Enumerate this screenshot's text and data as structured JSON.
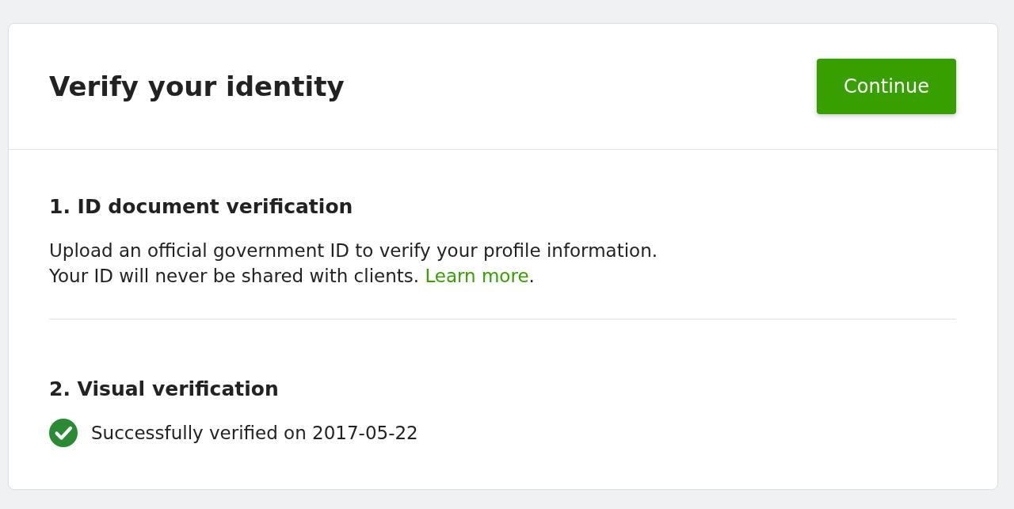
{
  "header": {
    "title": "Verify your identity",
    "button": "Continue"
  },
  "sections": [
    {
      "kind": "document",
      "heading": "1. ID document verification",
      "lines": [
        "Upload an official government ID to verify your profile information.",
        "Your ID will never be shared with clients. "
      ],
      "link": "Learn more",
      "after_link": "."
    },
    {
      "kind": "status",
      "heading": "2. Visual verification",
      "status": {
        "verified": true,
        "text": "Successfully verified on 2017-05-22"
      }
    }
  ]
}
